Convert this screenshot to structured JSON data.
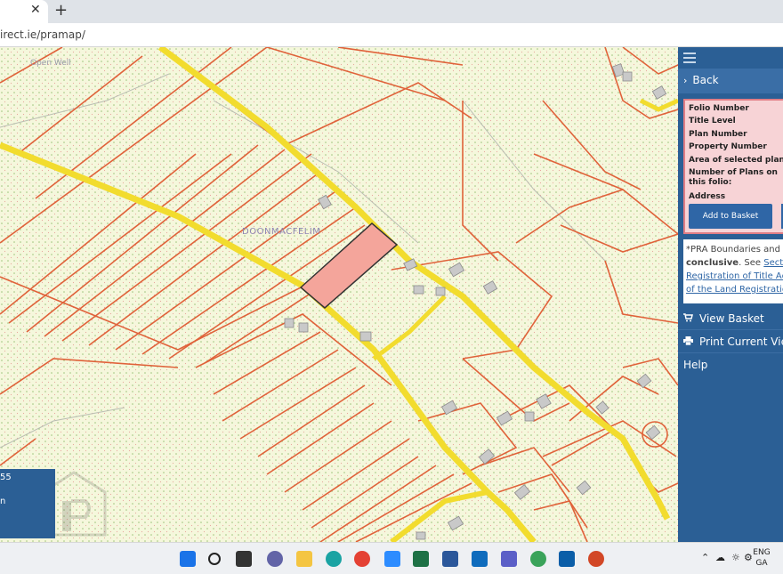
{
  "browser": {
    "tab_close": "✕",
    "new_tab": "+",
    "url": "irect.ie/pramap/"
  },
  "map": {
    "labels": [
      {
        "text": "Open Well"
      },
      {
        "text": "DOONMACFELIM"
      }
    ],
    "colors": {
      "background": "#f5f7dc",
      "boundary": "#e0623a",
      "road": "#f2dc2e",
      "selected": "#f4a59b",
      "building": "#c9c9c9"
    }
  },
  "legend": {
    "line1": "55",
    "line2": "n"
  },
  "panel": {
    "back_label": "Back",
    "folio_labels": [
      "Folio Number",
      "Title Level",
      "Plan Number",
      "Property Number",
      "Area of selected plans",
      "Number of Plans on",
      "this folio:",
      "Address"
    ],
    "add_to_basket": "Add to Basket",
    "disclaimer": {
      "line1": "*PRA Boundaries and Pla",
      "bold": "conclusive",
      "see": ". See ",
      "link1": "Section",
      "link2": "Registration of Title Ac",
      "link3": "of the Land Registratio"
    },
    "view_basket": "View Basket",
    "print_view": "Print Current View",
    "help": "Help"
  },
  "taskbar": {
    "lang_top": "ENG",
    "lang_bottom": "GA"
  }
}
